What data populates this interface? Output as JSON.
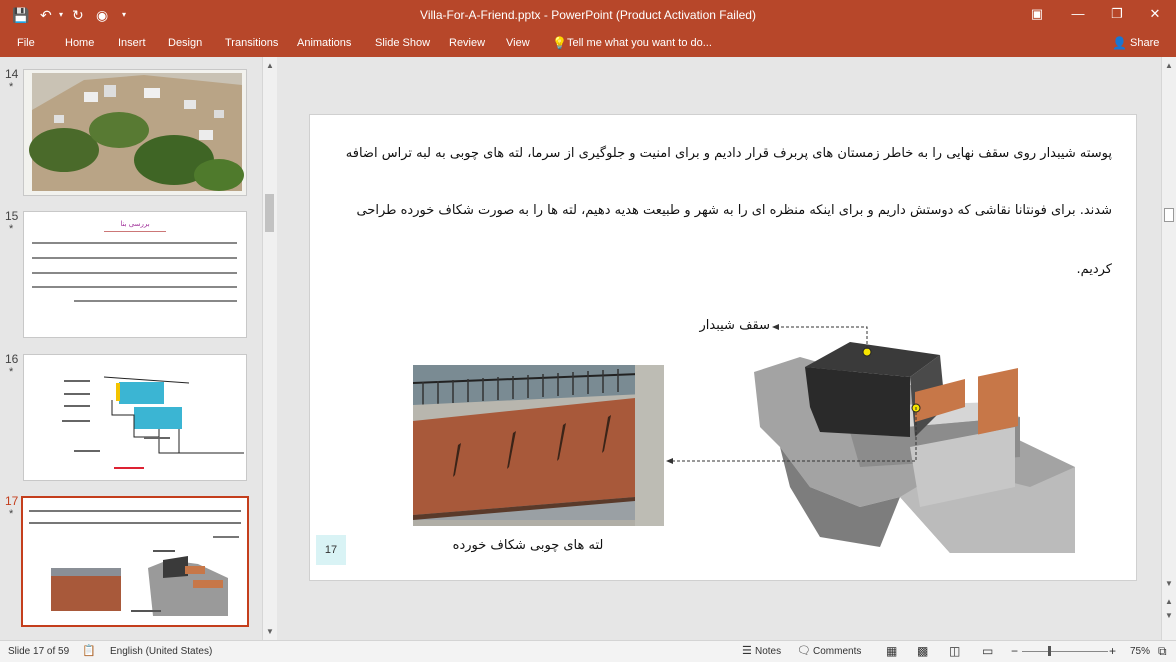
{
  "window": {
    "title": "Villa-For-A-Friend.pptx - PowerPoint (Product Activation Failed)"
  },
  "ribbon": {
    "tabs": [
      "File",
      "Home",
      "Insert",
      "Design",
      "Transitions",
      "Animations",
      "Slide Show",
      "Review",
      "View"
    ],
    "tell_me": "Tell me what you want to do...",
    "share": "Share"
  },
  "thumbnails": [
    {
      "number": "14",
      "star": "*"
    },
    {
      "number": "15",
      "star": "*",
      "title": "بررسی بنا"
    },
    {
      "number": "16",
      "star": "*"
    },
    {
      "number": "17",
      "star": "*"
    }
  ],
  "slide": {
    "number": "17",
    "paragraph_lines": [
      "پوسته شیبدار روی سقف نهایی را به خاطر زمستان های پربرف قرار دادیم و برای امنیت و جلوگیری از سرما، لته های چوبی به لبه تراس اضافه",
      "شدند. برای فونتانا نقاشی که دوستش داریم و برای اینکه منظره ای را به شهر و طبیعت هدیه دهیم، لته ها را به صورت شکاف خورده طراحی",
      "کردیم."
    ],
    "label_roof": "سقف شیبدار",
    "caption_wood": "لته های چوبی شکاف خورده"
  },
  "status": {
    "slide_info": "Slide 17 of 59",
    "language": "English (United States)",
    "notes": "Notes",
    "comments": "Comments",
    "zoom": "75%"
  },
  "colors": {
    "accent": "#b7472a",
    "selected_border": "#c43e1c",
    "wood": "#a8593a",
    "marker": "#f7e600"
  }
}
